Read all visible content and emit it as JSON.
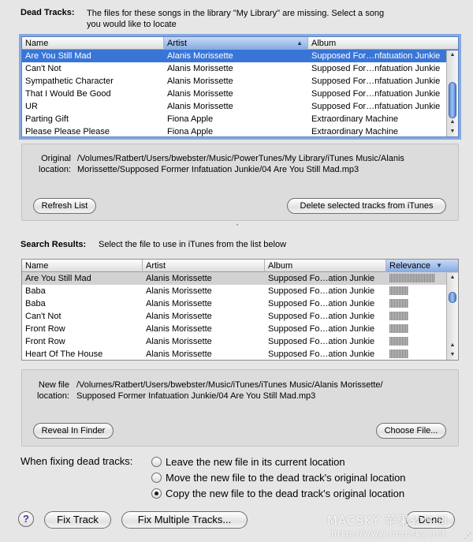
{
  "dead_tracks": {
    "label": "Dead Tracks:",
    "description_line1": "The files for these songs in the library \"My Library\" are missing.  Select a song",
    "description_line2": "you would like to locate",
    "columns": [
      "Name",
      "Artist",
      "Album"
    ],
    "rows": [
      [
        "Are You Still Mad",
        "Alanis Morissette",
        "Supposed For…nfatuation Junkie"
      ],
      [
        "Can't Not",
        "Alanis Morissette",
        "Supposed For…nfatuation Junkie"
      ],
      [
        "Sympathetic Character",
        "Alanis Morissette",
        "Supposed For…nfatuation Junkie"
      ],
      [
        "That I Would Be Good",
        "Alanis Morissette",
        "Supposed For…nfatuation Junkie"
      ],
      [
        "UR",
        "Alanis Morissette",
        "Supposed For…nfatuation Junkie"
      ],
      [
        "Parting Gift",
        "Fiona Apple",
        "Extraordinary Machine"
      ],
      [
        "Please Please Please",
        "Fiona Apple",
        "Extraordinary Machine"
      ]
    ],
    "original_location_label1": "Original",
    "original_location_label2": "location:",
    "original_location_line1": "/Volumes/Ratbert/Users/bwebster/Music/PowerTunes/My Library/iTunes Music/Alanis",
    "original_location_line2": "Morissette/Supposed Former Infatuation Junkie/04 Are You Still Mad.mp3",
    "refresh_button": "Refresh List",
    "delete_button": "Delete selected tracks from iTunes"
  },
  "search_results": {
    "label": "Search Results:",
    "description": "Select the file to use in iTunes from the list below",
    "columns": [
      "Name",
      "Artist",
      "Album",
      "Relevance"
    ],
    "rows": [
      {
        "name": "Are You Still Mad",
        "artist": "Alanis Morissette",
        "album": "Supposed Fo…ation Junkie",
        "relevance": 1.0
      },
      {
        "name": "Baba",
        "artist": "Alanis Morissette",
        "album": "Supposed Fo…ation Junkie",
        "relevance": 0.42
      },
      {
        "name": "Baba",
        "artist": "Alanis Morissette",
        "album": "Supposed Fo…ation Junkie",
        "relevance": 0.42
      },
      {
        "name": "Can't Not",
        "artist": "Alanis Morissette",
        "album": "Supposed Fo…ation Junkie",
        "relevance": 0.42
      },
      {
        "name": "Front Row",
        "artist": "Alanis Morissette",
        "album": "Supposed Fo…ation Junkie",
        "relevance": 0.42
      },
      {
        "name": "Front Row",
        "artist": "Alanis Morissette",
        "album": "Supposed Fo…ation Junkie",
        "relevance": 0.42
      },
      {
        "name": "Heart Of The House",
        "artist": "Alanis Morissette",
        "album": "Supposed Fo…ation Junkie",
        "relevance": 0.42
      }
    ],
    "new_file_label1": "New file",
    "new_file_label2": "location:",
    "new_file_line1": "/Volumes/Ratbert/Users/bwebster/Music/iTunes/iTunes Music/Alanis Morissette/",
    "new_file_line2": "Supposed Former Infatuation Junkie/04 Are You Still Mad.mp3",
    "reveal_button": "Reveal In Finder",
    "choose_button": "Choose File..."
  },
  "fixing": {
    "label": "When fixing dead tracks:",
    "options": [
      "Leave the new file in its current location",
      "Move the new file to the dead track's original location",
      "Copy the new file to the dead track's original location"
    ],
    "selected_index": 2
  },
  "footer": {
    "help": "?",
    "fix_track": "Fix Track",
    "fix_multiple": "Fix Multiple Tracks...",
    "done": "Done"
  },
  "watermark": {
    "line1": "MACSKY 苹果软件园",
    "line2": "http://www.macsky.net"
  },
  "colors": {
    "selection_blue": "#3875d7",
    "focus_ring": "#86a9df",
    "radio_accent": "#1c1c1c"
  }
}
